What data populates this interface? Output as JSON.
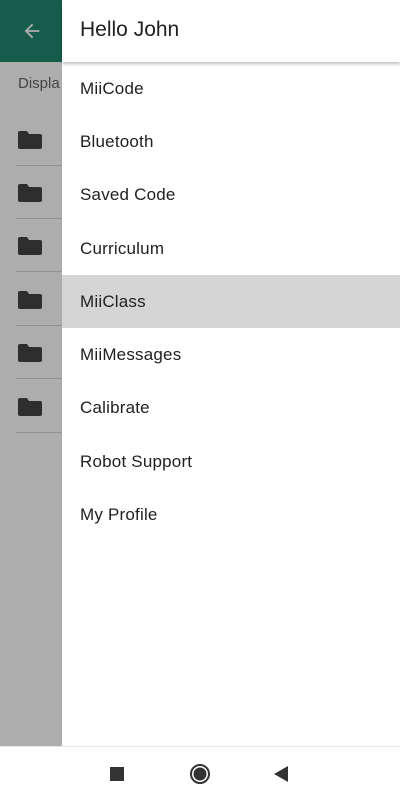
{
  "drawer": {
    "greeting": "Hello John",
    "items": [
      {
        "label": "MiiCode",
        "selected": false
      },
      {
        "label": "Bluetooth",
        "selected": false
      },
      {
        "label": "Saved Code",
        "selected": false
      },
      {
        "label": "Curriculum",
        "selected": false
      },
      {
        "label": "MiiClass",
        "selected": true
      },
      {
        "label": "MiiMessages",
        "selected": false
      },
      {
        "label": "Calibrate",
        "selected": false
      },
      {
        "label": "Robot Support",
        "selected": false
      },
      {
        "label": "My Profile",
        "selected": false
      }
    ]
  },
  "background": {
    "appbar_color": "#1f8a6d",
    "back_icon": "arrow-left-icon",
    "subtitle": "Displa",
    "folder_icon": "folder-icon",
    "folder_rows": 6
  },
  "navbar": {
    "recents_icon": "square-icon",
    "home_icon": "circle-icon",
    "back_icon": "triangle-back-icon"
  },
  "colors": {
    "accent": "#1f8a6d",
    "selected_row": "#d5d5d5",
    "scrim": "rgba(0,0,0,0.32)"
  }
}
